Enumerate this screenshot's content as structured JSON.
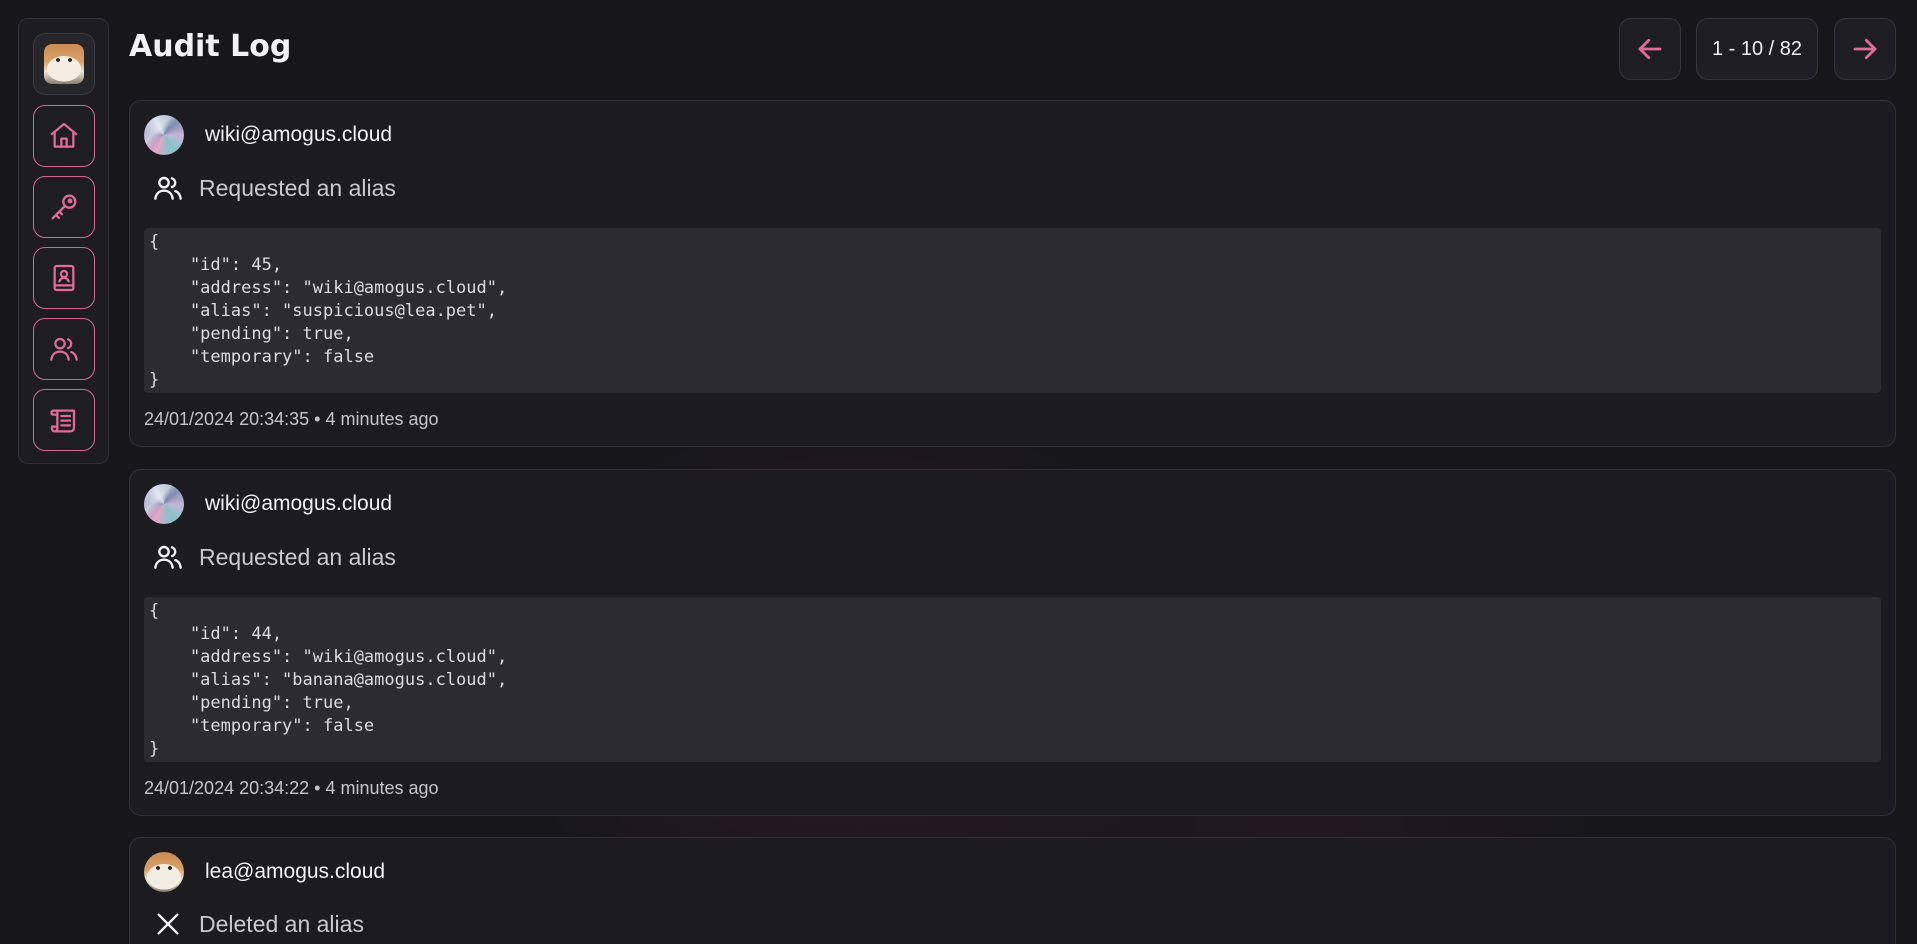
{
  "page": {
    "title": "Audit Log"
  },
  "pagination": {
    "range_text": "1 - 10 / 82"
  },
  "sidebar": {
    "items": [
      {
        "name": "home",
        "icon": "home-icon"
      },
      {
        "name": "keys",
        "icon": "key-icon"
      },
      {
        "name": "contacts",
        "icon": "contact-book-icon"
      },
      {
        "name": "users",
        "icon": "users-icon"
      },
      {
        "name": "audit-log",
        "icon": "scroll-icon"
      }
    ]
  },
  "entries": [
    {
      "user": "wiki@amogus.cloud",
      "action": "Requested an alias",
      "action_icon": "users-icon",
      "payload": "{\n    \"id\": 45,\n    \"address\": \"wiki@amogus.cloud\",\n    \"alias\": \"suspicious@lea.pet\",\n    \"pending\": true,\n    \"temporary\": false\n}",
      "timestamp": "24/01/2024 20:34:35 • 4 minutes ago"
    },
    {
      "user": "wiki@amogus.cloud",
      "action": "Requested an alias",
      "action_icon": "users-icon",
      "payload": "{\n    \"id\": 44,\n    \"address\": \"wiki@amogus.cloud\",\n    \"alias\": \"banana@amogus.cloud\",\n    \"pending\": true,\n    \"temporary\": false\n}",
      "timestamp": "24/01/2024 20:34:22 • 4 minutes ago"
    },
    {
      "user": "lea@amogus.cloud",
      "action": "Deleted an alias",
      "action_icon": "close-icon"
    }
  ],
  "colors": {
    "accent": "#e06c94",
    "background": "#17171a",
    "card": "#1c1c20",
    "code_background": "#2b2b30"
  }
}
